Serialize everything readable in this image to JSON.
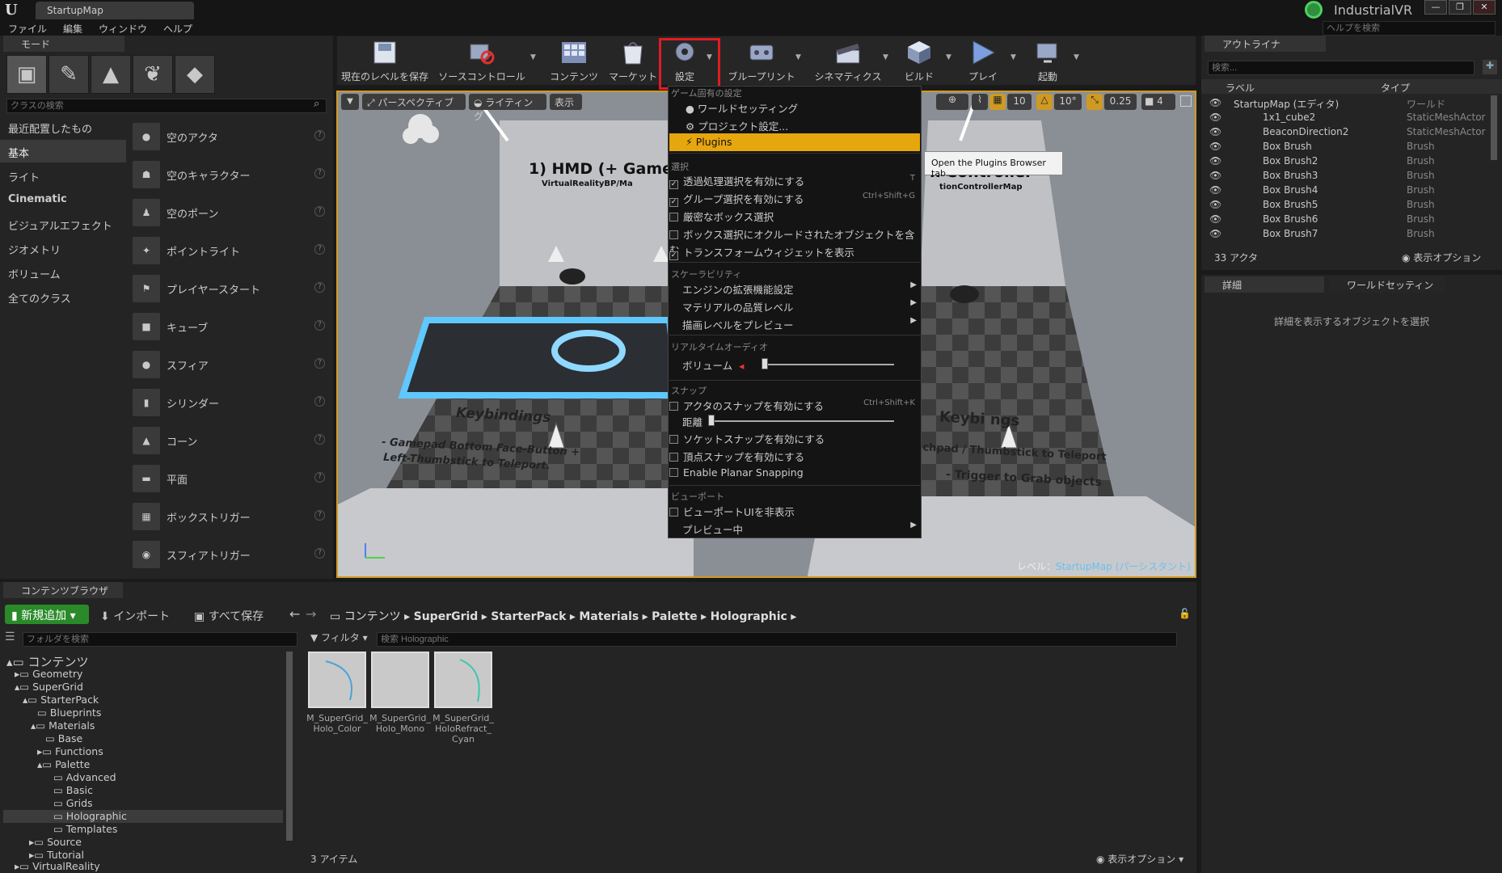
{
  "window": {
    "tab": "StartupMap",
    "project": "IndustrialVR",
    "min": "—",
    "max": "❐",
    "close": "✕"
  },
  "menu": {
    "file": "ファイル",
    "edit": "編集",
    "window": "ウィンドウ",
    "help": "ヘルプ",
    "help_placeholder": "ヘルプを検索"
  },
  "modes": {
    "title": "モード",
    "search_placeholder": "クラスの検索",
    "categories": [
      "最近配置したもの",
      "基本",
      "ライト",
      "Cinematic",
      "ビジュアルエフェクト",
      "ジオメトリ",
      "ボリューム",
      "全てのクラス"
    ],
    "items": [
      "空のアクタ",
      "空のキャラクター",
      "空のポーン",
      "ポイントライト",
      "プレイヤースタート",
      "キューブ",
      "スフィア",
      "シリンダー",
      "コーン",
      "平面",
      "ボックストリガー",
      "スフィアトリガー"
    ]
  },
  "toolbar": {
    "buttons": [
      "現在のレベルを保存",
      "ソースコントロール",
      "コンテンツ",
      "マーケット",
      "設定",
      "ブループリント",
      "シネマティクス",
      "ビルド",
      "プレイ",
      "起動"
    ]
  },
  "viewport": {
    "perspective": "パースペクティブ",
    "lighting": "ライティング",
    "show": "表示",
    "grid_value": "10",
    "rotation_value": "10°",
    "scale_value": "0.25",
    "camera_speed": "4",
    "level_label": "レベル：",
    "level_name": "StartupMap (パーシスタント)",
    "sign_left_title": "1) HMD (+ Gamepa",
    "sign_left_sub": "VirtualRealityBP/Ma",
    "sign_right_title": "n Controller",
    "sign_right_sub": "tionControllerMap",
    "floor_left_title": "Keybindings",
    "floor_left_line1": "- Gamepad Bottom Face-Button +",
    "floor_left_line2": "Left-Thumbstick to Teleport.",
    "floor_right_title": "Keybi  ngs",
    "floor_right_line1": "uchpad / Thumbstick to Teleport",
    "floor_right_line2": "- Trigger to Grab objects"
  },
  "dropdown": {
    "sec_game": "ゲーム固有の設定",
    "world_settings": "ワールドセッティング",
    "project_settings": "プロジェクト設定...",
    "plugins": "Plugins",
    "sec_select": "選択",
    "opt_translucent": "透過処理選択を有効にする",
    "opt_translucent_sc": "T",
    "opt_group": "グループ選択を有効にする",
    "opt_group_sc": "Ctrl+Shift+G",
    "opt_strict": "厳密なボックス選択",
    "opt_occluded": "ボックス選択にオクルードされたオブジェクトを含む",
    "opt_widget": "トランスフォームウィジェットを表示",
    "sec_scalability": "スケーラビリティ",
    "engine_scal": "エンジンの拡張機能設定",
    "material_quality": "マテリアルの品質レベル",
    "preview_render": "描画レベルをプレビュー",
    "sec_audio": "リアルタイムオーディオ",
    "volume": "ボリューム",
    "sec_snap": "スナップ",
    "actor_snap": "アクタのスナップを有効にする",
    "actor_snap_sc": "Ctrl+Shift+K",
    "distance": "距離",
    "socket_snap": "ソケットスナップを有効にする",
    "vertex_snap": "頂点スナップを有効にする",
    "planar_snap": "Enable Planar Snapping",
    "sec_viewport": "ビューポート",
    "hide_ui": "ビューポートUIを非表示",
    "previewing": "プレビュー中",
    "checkmark": "✓",
    "submenu_arrow": "▶"
  },
  "tooltip": "Open the Plugins Browser tab.",
  "outliner": {
    "title": "アウトライナ",
    "search_placeholder": "検索...",
    "col_label": "ラベル",
    "col_type": "タイプ",
    "rows": [
      {
        "label": "StartupMap (エディタ)",
        "type": "ワールド"
      },
      {
        "label": "1x1_cube2",
        "type": "StaticMeshActor"
      },
      {
        "label": "BeaconDirection2",
        "type": "StaticMeshActor"
      },
      {
        "label": "Box Brush",
        "type": "Brush"
      },
      {
        "label": "Box Brush2",
        "type": "Brush"
      },
      {
        "label": "Box Brush3",
        "type": "Brush"
      },
      {
        "label": "Box Brush4",
        "type": "Brush"
      },
      {
        "label": "Box Brush5",
        "type": "Brush"
      },
      {
        "label": "Box Brush6",
        "type": "Brush"
      },
      {
        "label": "Box Brush7",
        "type": "Brush"
      }
    ],
    "count": "33 アクタ",
    "view_options": "表示オプション"
  },
  "details": {
    "tab_details": "詳細",
    "tab_world": "ワールドセッティン",
    "empty_msg": "詳細を表示するオブジェクトを選択"
  },
  "content_browser": {
    "title": "コンテンツブラウザ",
    "add_new": "新規追加",
    "import": "インポート",
    "save_all": "すべて保存",
    "path": [
      "コンテンツ",
      "SuperGrid",
      "StarterPack",
      "Materials",
      "Palette",
      "Holographic"
    ],
    "folder_search": "フォルダを検索",
    "filter": "フィルタ",
    "asset_search": "検索 Holographic",
    "tree": [
      "コンテンツ",
      "Geometry",
      "SuperGrid",
      "StarterPack",
      "Blueprints",
      "Materials",
      "Base",
      "Functions",
      "Palette",
      "Advanced",
      "Basic",
      "Grids",
      "Holographic",
      "Templates",
      "Source",
      "Tutorial",
      "VirtualReality"
    ],
    "assets": [
      "M_SuperGrid_ Holo_Color",
      "M_SuperGrid_ Holo_Mono",
      "M_SuperGrid_ HoloRefract_ Cyan"
    ],
    "item_count": "3 アイテム",
    "view_options": "表示オプション"
  },
  "colors": {
    "accent": "#e6a60d",
    "highlight_box": "#e01b24",
    "viewport_border": "#cf9a22",
    "add_new": "#2a8a2a"
  },
  "icons": [
    "save-icon",
    "source-control-icon",
    "content-icon",
    "marketplace-icon",
    "settings-icon",
    "blueprint-icon",
    "cinematics-icon",
    "build-icon",
    "play-icon",
    "launch-icon"
  ]
}
